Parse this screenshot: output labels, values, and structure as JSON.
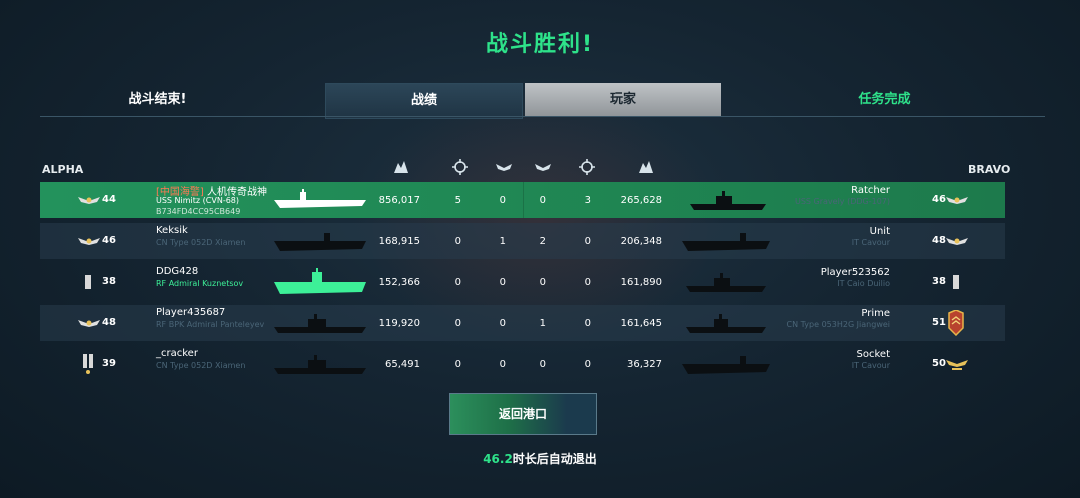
{
  "header": {
    "title": "战斗胜利!"
  },
  "tabs": {
    "status": "战斗结束!",
    "stats": "战绩",
    "players": "玩家",
    "mission": "任务完成"
  },
  "teams": {
    "left": "ALPHA",
    "right": "BRAVO"
  },
  "rows": [
    {
      "l_level": "44",
      "l_tag": "[中国海警]",
      "l_name": " 人机传奇战神",
      "l_ship": "USS Nimitz (CVN-68)",
      "l_id": "B734FD4CC95CB649",
      "l_score": "856,017",
      "l_a": "5",
      "l_b": "0",
      "r_b": "0",
      "r_a": "3",
      "r_score": "265,628",
      "r_name": "Ratcher",
      "r_ship": "USS Gravely (DDG-107)",
      "r_level": "46"
    },
    {
      "l_level": "46",
      "l_name": "Keksik",
      "l_ship": "CN Type 052D Xiamen",
      "l_score": "168,915",
      "l_a": "0",
      "l_b": "1",
      "r_b": "2",
      "r_a": "0",
      "r_score": "206,348",
      "r_name": "Unit",
      "r_ship": "IT Cavour",
      "r_level": "48"
    },
    {
      "l_level": "38",
      "l_name": "DDG428",
      "l_ship": "RF Admiral Kuznetsov",
      "l_score": "152,366",
      "l_a": "0",
      "l_b": "0",
      "r_b": "0",
      "r_a": "0",
      "r_score": "161,890",
      "r_name": "Player523562",
      "r_ship": "IT Caio Duilio",
      "r_level": "38"
    },
    {
      "l_level": "48",
      "l_name": "Player435687",
      "l_ship": "RF BPK Admiral Panteleyev",
      "l_score": "119,920",
      "l_a": "0",
      "l_b": "0",
      "r_b": "1",
      "r_a": "0",
      "r_score": "161,645",
      "r_name": "Prime",
      "r_ship": "CN Type 053H2G Jiangwei",
      "r_level": "51"
    },
    {
      "l_level": "39",
      "l_name": "_cracker",
      "l_ship": "CN Type 052D Xiamen",
      "l_score": "65,491",
      "l_a": "0",
      "l_b": "0",
      "r_b": "0",
      "r_a": "0",
      "r_score": "36,327",
      "r_name": "Socket",
      "r_ship": "IT Cavour",
      "r_level": "50"
    }
  ],
  "footer": {
    "return_button": "返回港口",
    "countdown_value": "46.2",
    "countdown_text": "时长后自动退出"
  },
  "colors": {
    "accent": "#2ee28a",
    "highlight_row": "#1f8552",
    "tag": "#ff7a55"
  }
}
